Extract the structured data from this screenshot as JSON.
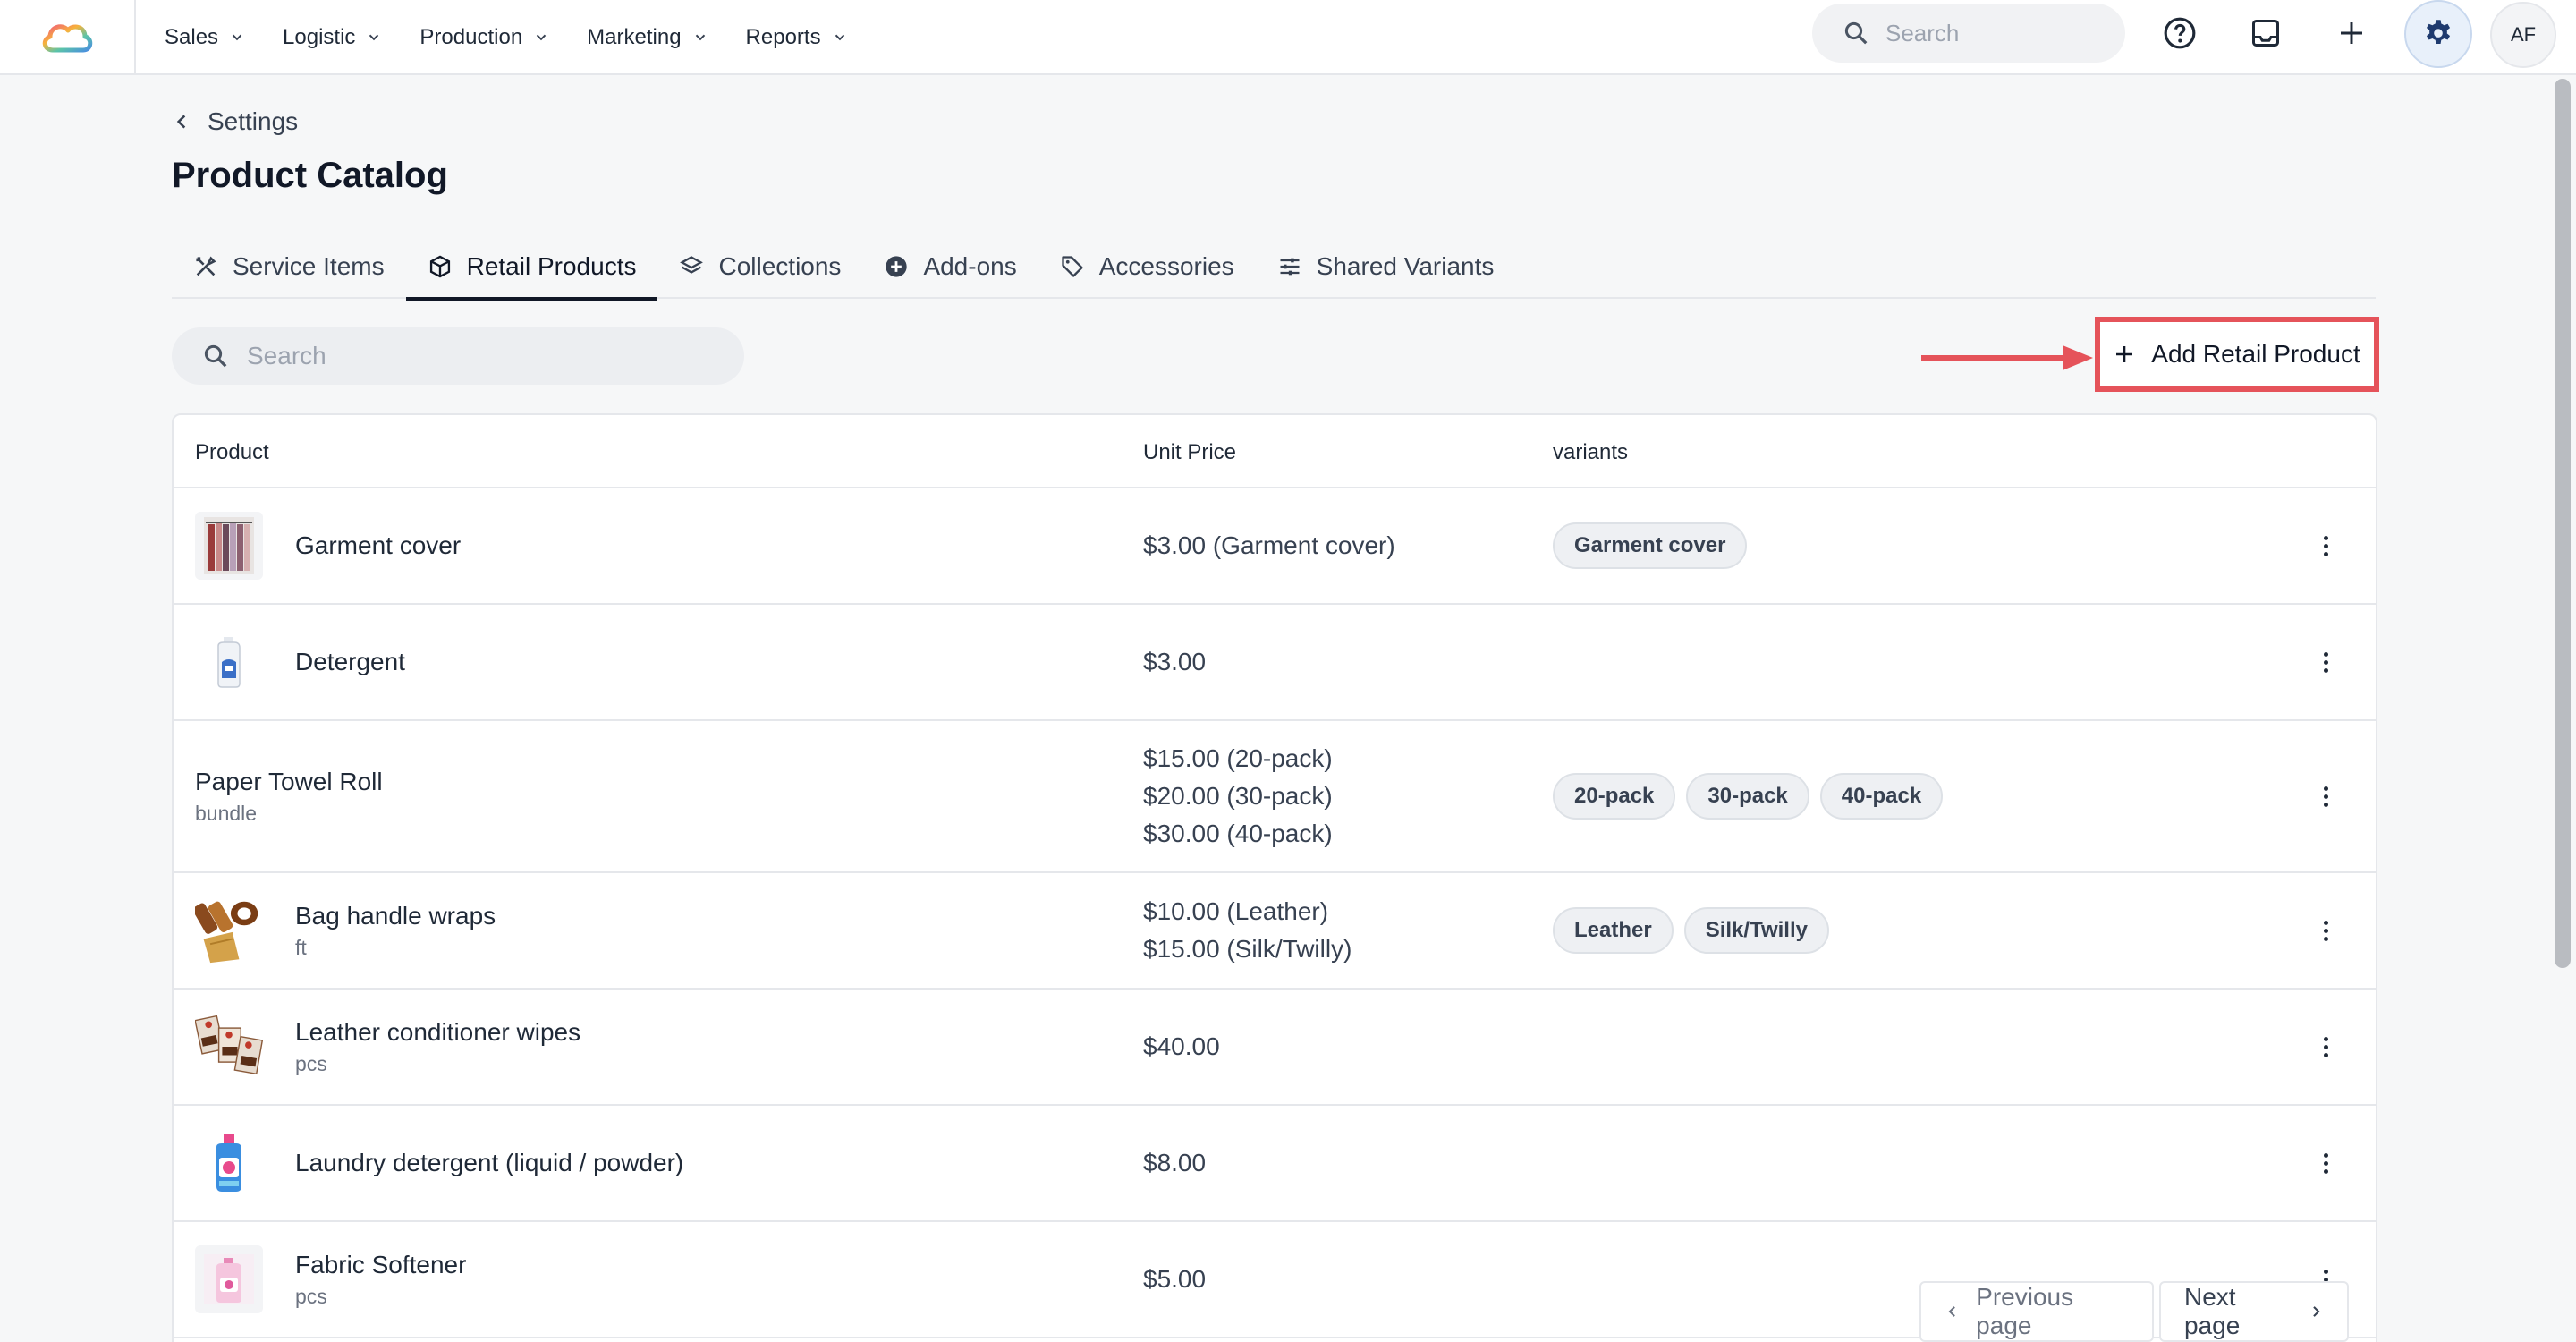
{
  "nav": {
    "items": [
      {
        "label": "Sales"
      },
      {
        "label": "Logistic"
      },
      {
        "label": "Production"
      },
      {
        "label": "Marketing"
      },
      {
        "label": "Reports"
      }
    ],
    "search_placeholder": "Search",
    "avatar_initials": "AF"
  },
  "breadcrumb": {
    "label": "Settings"
  },
  "page": {
    "title": "Product Catalog"
  },
  "tabs": [
    {
      "label": "Service Items",
      "icon": "tools-icon"
    },
    {
      "label": "Retail Products",
      "icon": "box-icon",
      "active": true
    },
    {
      "label": "Collections",
      "icon": "layers-icon"
    },
    {
      "label": "Add-ons",
      "icon": "plus-circle-icon"
    },
    {
      "label": "Accessories",
      "icon": "tag-icon"
    },
    {
      "label": "Shared Variants",
      "icon": "sliders-icon"
    }
  ],
  "toolbar": {
    "search_placeholder": "Search",
    "add_label": "Add Retail Product",
    "highlight_color": "#e5535a"
  },
  "table": {
    "columns": [
      "Product",
      "Unit Price",
      "variants"
    ],
    "rows": [
      {
        "name": "Garment cover",
        "sub": "",
        "prices": [
          "$3.00 (Garment cover)"
        ],
        "variants": [
          "Garment cover"
        ]
      },
      {
        "name": "Detergent",
        "sub": "",
        "prices": [
          "$3.00"
        ],
        "variants": []
      },
      {
        "name": "Paper Towel Roll",
        "sub": "bundle",
        "prices": [
          "$15.00 (20-pack)",
          "$20.00 (30-pack)",
          "$30.00 (40-pack)"
        ],
        "variants": [
          "20-pack",
          "30-pack",
          "40-pack"
        ]
      },
      {
        "name": "Bag handle wraps",
        "sub": "ft",
        "prices": [
          "$10.00 (Leather)",
          "$15.00 (Silk/Twilly)"
        ],
        "variants": [
          "Leather",
          "Silk/Twilly"
        ]
      },
      {
        "name": "Leather conditioner wipes",
        "sub": "pcs",
        "prices": [
          "$40.00"
        ],
        "variants": []
      },
      {
        "name": "Laundry detergent (liquid / powder)",
        "sub": "",
        "prices": [
          "$8.00"
        ],
        "variants": []
      },
      {
        "name": "Fabric Softener",
        "sub": "pcs",
        "prices": [
          "$5.00"
        ],
        "variants": []
      }
    ]
  },
  "pagination": {
    "prev_label": "Previous page",
    "next_label": "Next page"
  }
}
